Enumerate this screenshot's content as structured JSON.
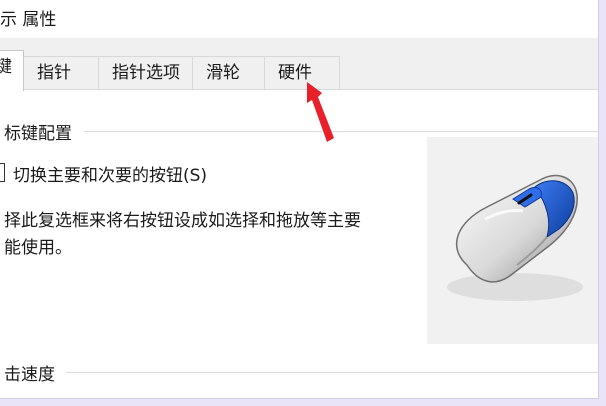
{
  "window": {
    "title": "示 属性"
  },
  "tabs": [
    {
      "label": "键",
      "active": true
    },
    {
      "label": "指针",
      "active": false
    },
    {
      "label": "指针选项",
      "active": false
    },
    {
      "label": "滑轮",
      "active": false
    },
    {
      "label": "硬件",
      "active": false
    }
  ],
  "button_config": {
    "group_label": "标键配置",
    "checkbox_label": "切换主要和次要的按钮(S)",
    "checked": false,
    "description_line1": "择此复选框来将右按钮设成如选择和拖放等主要",
    "description_line2": "能使用。"
  },
  "click_speed": {
    "group_label": "击速度"
  },
  "image": {
    "icon": "mouse-icon"
  },
  "annotation": {
    "color": "#e8202a",
    "icon": "red-arrow-icon"
  },
  "colors": {
    "mouse_accent": "#1f5fd0",
    "page_background": "#e9e4f7"
  }
}
